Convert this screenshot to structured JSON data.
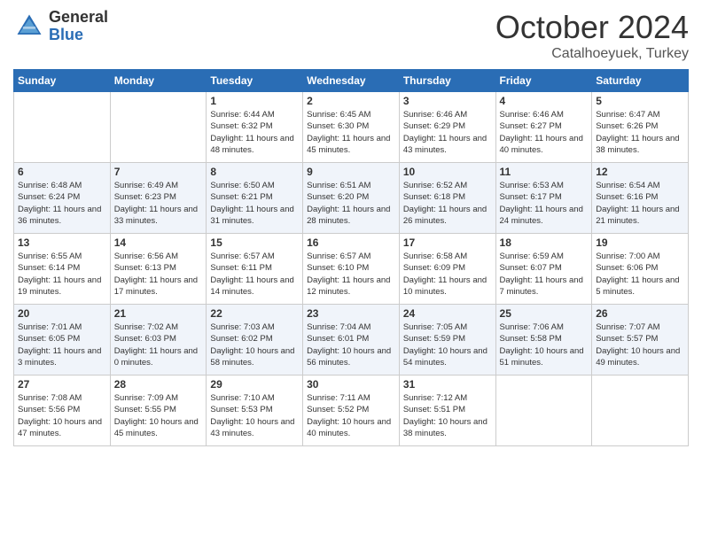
{
  "header": {
    "logo_general": "General",
    "logo_blue": "Blue",
    "month": "October 2024",
    "location": "Catalhoeyuek, Turkey"
  },
  "days_of_week": [
    "Sunday",
    "Monday",
    "Tuesday",
    "Wednesday",
    "Thursday",
    "Friday",
    "Saturday"
  ],
  "weeks": [
    [
      {
        "day": "",
        "info": ""
      },
      {
        "day": "",
        "info": ""
      },
      {
        "day": "1",
        "info": "Sunrise: 6:44 AM\nSunset: 6:32 PM\nDaylight: 11 hours and 48 minutes."
      },
      {
        "day": "2",
        "info": "Sunrise: 6:45 AM\nSunset: 6:30 PM\nDaylight: 11 hours and 45 minutes."
      },
      {
        "day": "3",
        "info": "Sunrise: 6:46 AM\nSunset: 6:29 PM\nDaylight: 11 hours and 43 minutes."
      },
      {
        "day": "4",
        "info": "Sunrise: 6:46 AM\nSunset: 6:27 PM\nDaylight: 11 hours and 40 minutes."
      },
      {
        "day": "5",
        "info": "Sunrise: 6:47 AM\nSunset: 6:26 PM\nDaylight: 11 hours and 38 minutes."
      }
    ],
    [
      {
        "day": "6",
        "info": "Sunrise: 6:48 AM\nSunset: 6:24 PM\nDaylight: 11 hours and 36 minutes."
      },
      {
        "day": "7",
        "info": "Sunrise: 6:49 AM\nSunset: 6:23 PM\nDaylight: 11 hours and 33 minutes."
      },
      {
        "day": "8",
        "info": "Sunrise: 6:50 AM\nSunset: 6:21 PM\nDaylight: 11 hours and 31 minutes."
      },
      {
        "day": "9",
        "info": "Sunrise: 6:51 AM\nSunset: 6:20 PM\nDaylight: 11 hours and 28 minutes."
      },
      {
        "day": "10",
        "info": "Sunrise: 6:52 AM\nSunset: 6:18 PM\nDaylight: 11 hours and 26 minutes."
      },
      {
        "day": "11",
        "info": "Sunrise: 6:53 AM\nSunset: 6:17 PM\nDaylight: 11 hours and 24 minutes."
      },
      {
        "day": "12",
        "info": "Sunrise: 6:54 AM\nSunset: 6:16 PM\nDaylight: 11 hours and 21 minutes."
      }
    ],
    [
      {
        "day": "13",
        "info": "Sunrise: 6:55 AM\nSunset: 6:14 PM\nDaylight: 11 hours and 19 minutes."
      },
      {
        "day": "14",
        "info": "Sunrise: 6:56 AM\nSunset: 6:13 PM\nDaylight: 11 hours and 17 minutes."
      },
      {
        "day": "15",
        "info": "Sunrise: 6:57 AM\nSunset: 6:11 PM\nDaylight: 11 hours and 14 minutes."
      },
      {
        "day": "16",
        "info": "Sunrise: 6:57 AM\nSunset: 6:10 PM\nDaylight: 11 hours and 12 minutes."
      },
      {
        "day": "17",
        "info": "Sunrise: 6:58 AM\nSunset: 6:09 PM\nDaylight: 11 hours and 10 minutes."
      },
      {
        "day": "18",
        "info": "Sunrise: 6:59 AM\nSunset: 6:07 PM\nDaylight: 11 hours and 7 minutes."
      },
      {
        "day": "19",
        "info": "Sunrise: 7:00 AM\nSunset: 6:06 PM\nDaylight: 11 hours and 5 minutes."
      }
    ],
    [
      {
        "day": "20",
        "info": "Sunrise: 7:01 AM\nSunset: 6:05 PM\nDaylight: 11 hours and 3 minutes."
      },
      {
        "day": "21",
        "info": "Sunrise: 7:02 AM\nSunset: 6:03 PM\nDaylight: 11 hours and 0 minutes."
      },
      {
        "day": "22",
        "info": "Sunrise: 7:03 AM\nSunset: 6:02 PM\nDaylight: 10 hours and 58 minutes."
      },
      {
        "day": "23",
        "info": "Sunrise: 7:04 AM\nSunset: 6:01 PM\nDaylight: 10 hours and 56 minutes."
      },
      {
        "day": "24",
        "info": "Sunrise: 7:05 AM\nSunset: 5:59 PM\nDaylight: 10 hours and 54 minutes."
      },
      {
        "day": "25",
        "info": "Sunrise: 7:06 AM\nSunset: 5:58 PM\nDaylight: 10 hours and 51 minutes."
      },
      {
        "day": "26",
        "info": "Sunrise: 7:07 AM\nSunset: 5:57 PM\nDaylight: 10 hours and 49 minutes."
      }
    ],
    [
      {
        "day": "27",
        "info": "Sunrise: 7:08 AM\nSunset: 5:56 PM\nDaylight: 10 hours and 47 minutes."
      },
      {
        "day": "28",
        "info": "Sunrise: 7:09 AM\nSunset: 5:55 PM\nDaylight: 10 hours and 45 minutes."
      },
      {
        "day": "29",
        "info": "Sunrise: 7:10 AM\nSunset: 5:53 PM\nDaylight: 10 hours and 43 minutes."
      },
      {
        "day": "30",
        "info": "Sunrise: 7:11 AM\nSunset: 5:52 PM\nDaylight: 10 hours and 40 minutes."
      },
      {
        "day": "31",
        "info": "Sunrise: 7:12 AM\nSunset: 5:51 PM\nDaylight: 10 hours and 38 minutes."
      },
      {
        "day": "",
        "info": ""
      },
      {
        "day": "",
        "info": ""
      }
    ]
  ]
}
